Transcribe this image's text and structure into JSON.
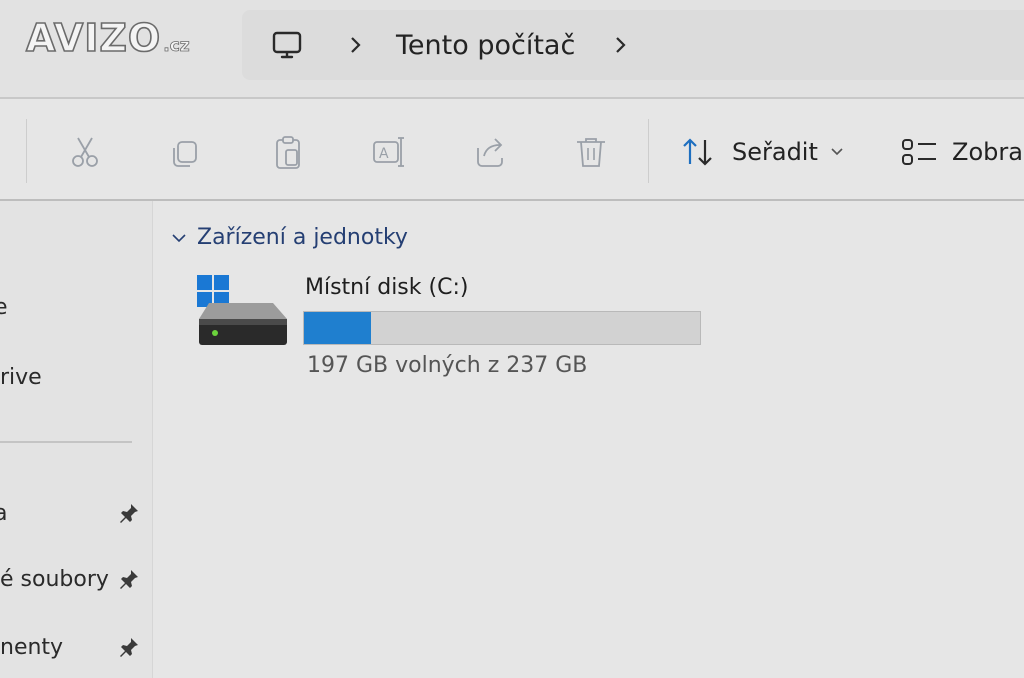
{
  "watermark": {
    "brand": "AVIZO",
    "tld": ".cz"
  },
  "address_bar": {
    "root_icon": "monitor-icon",
    "breadcrumbs": [
      "Tento počítač"
    ]
  },
  "toolbar": {
    "buttons": [
      {
        "name": "cut",
        "icon": "scissors-icon"
      },
      {
        "name": "copy",
        "icon": "copy-icon"
      },
      {
        "name": "paste",
        "icon": "clipboard-icon"
      },
      {
        "name": "rename",
        "icon": "rename-icon"
      },
      {
        "name": "share",
        "icon": "share-icon"
      },
      {
        "name": "delete",
        "icon": "trash-icon"
      }
    ],
    "sort_label": "Seřadit",
    "view_label": "Zobra"
  },
  "sidebar": {
    "items": [
      {
        "label": "e"
      },
      {
        "label": "rive"
      },
      {
        "label": "a",
        "pinned": true
      },
      {
        "label": "é soubory",
        "pinned": true
      },
      {
        "label": "nenty",
        "pinned": true
      }
    ]
  },
  "main": {
    "group_label": "Zařízení a jednotky",
    "drives": [
      {
        "name": "Místní disk (C:)",
        "space_text": "197 GB volných z 237 GB",
        "used_fraction": 0.169,
        "bar_color": "#1f7fcf"
      }
    ]
  },
  "colors": {
    "accent": "#1f7fcf",
    "group_header": "#253f73"
  }
}
